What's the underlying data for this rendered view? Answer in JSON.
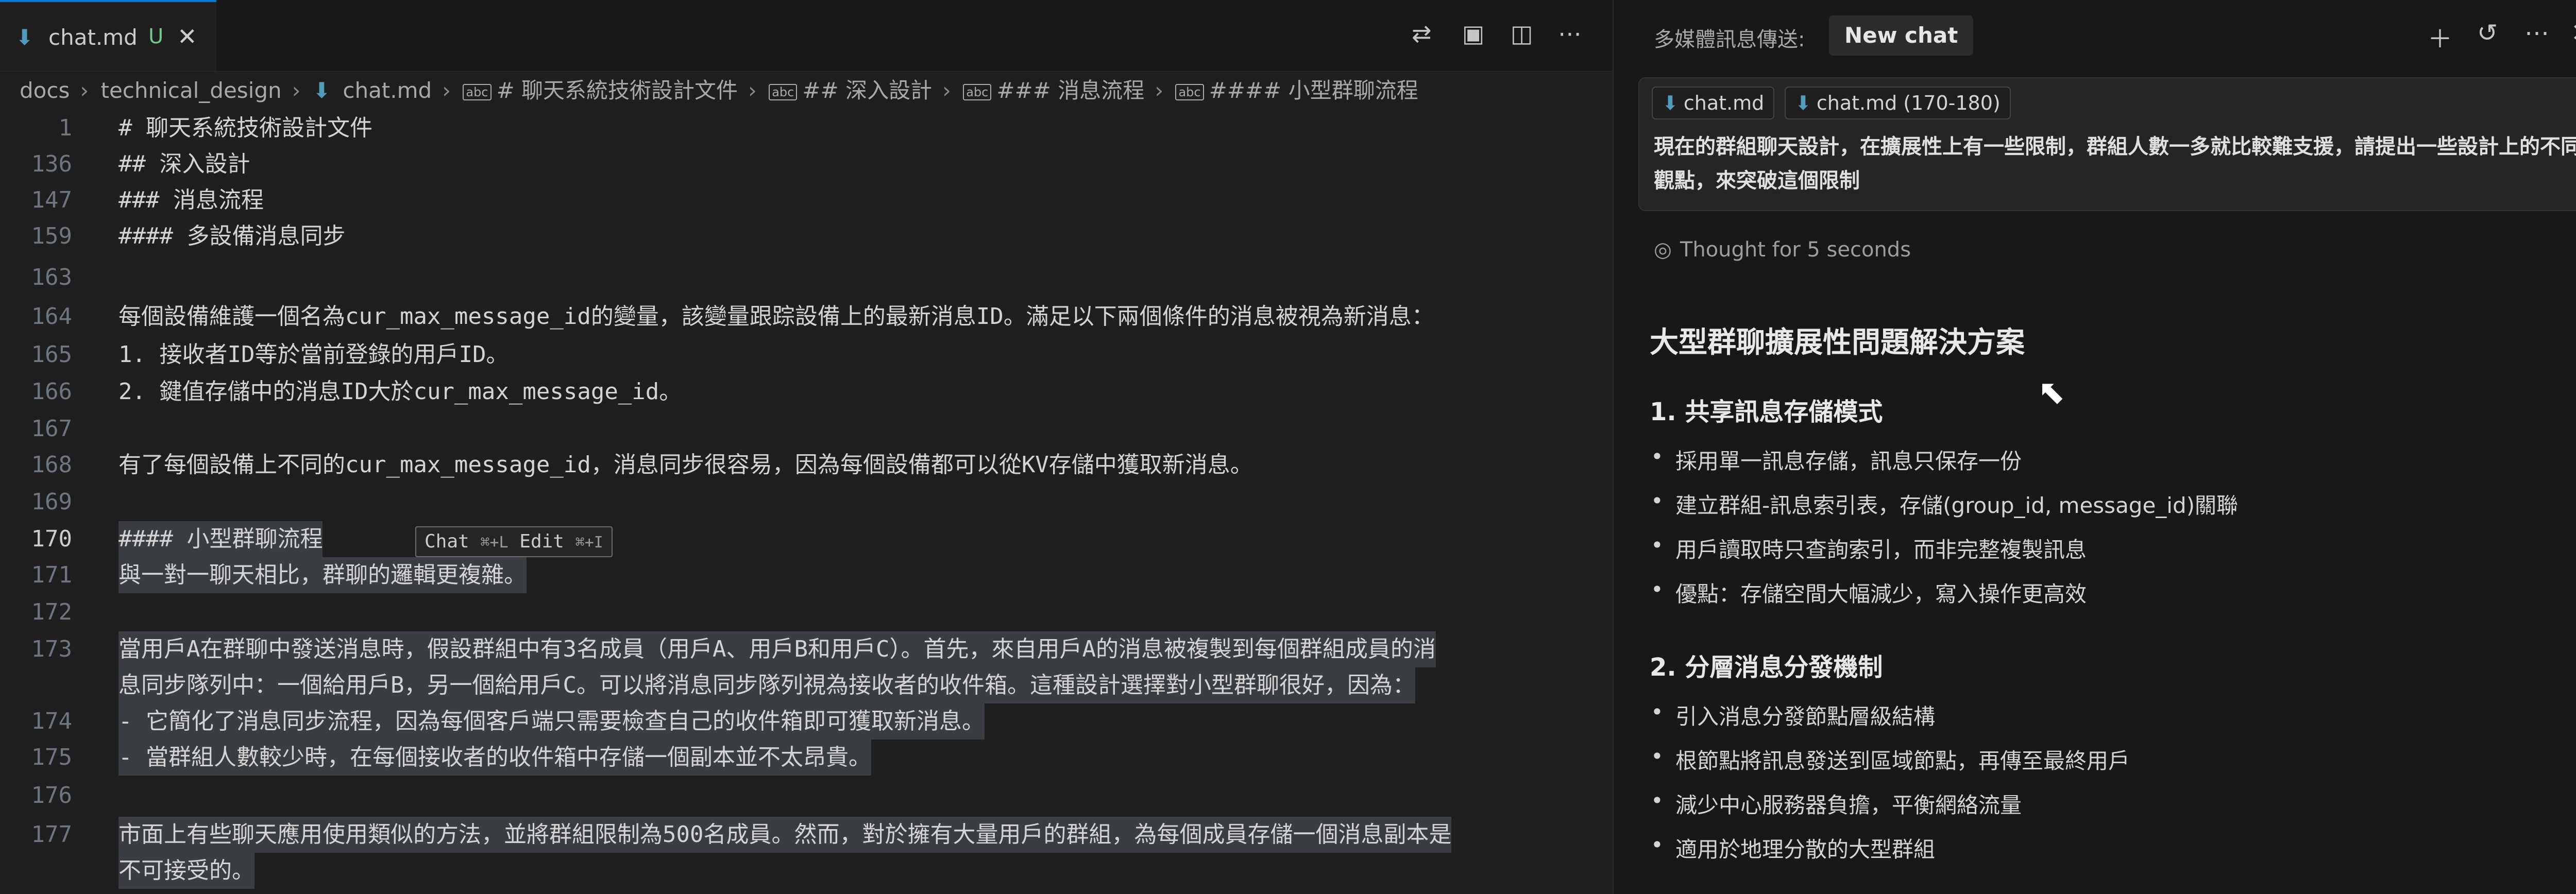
{
  "editor": {
    "tab": {
      "icon": "markdown-icon",
      "name": "chat.md",
      "status": "U",
      "close": "✕"
    },
    "breadcrumb": [
      "docs",
      "technical_design",
      "chat.md",
      "# 聊天系統技術設計文件",
      "## 深入設計",
      "### 消息流程",
      "#### 小型群聊流程"
    ],
    "lines": [
      {
        "num": "1",
        "text": "# 聊天系統技術設計文件"
      },
      {
        "num": "136",
        "text": "## 深入設計"
      },
      {
        "num": "147",
        "text": "### 消息流程"
      },
      {
        "num": "159",
        "text": "#### 多設備消息同步"
      },
      {
        "num": "163",
        "text": ""
      },
      {
        "num": "164",
        "text": "每個設備維護一個名為cur_max_message_id的變量，該變量跟踪設備上的最新消息ID。滿足以下兩個條件的消息被視為新消息："
      },
      {
        "num": "165",
        "text": "1. 接收者ID等於當前登錄的用戶ID。"
      },
      {
        "num": "166",
        "text": "2. 鍵值存儲中的消息ID大於cur_max_message_id。"
      },
      {
        "num": "167",
        "text": ""
      },
      {
        "num": "168",
        "text": "有了每個設備上不同的cur_max_message_id，消息同步很容易，因為每個設備都可以從KV存儲中獲取新消息。"
      },
      {
        "num": "169",
        "text": ""
      },
      {
        "num": "170",
        "text": "#### 小型群聊流程"
      },
      {
        "num": "171",
        "text": "與一對一聊天相比，群聊的邏輯更複雜。"
      },
      {
        "num": "172",
        "text": ""
      },
      {
        "num": "173",
        "text": "當用戶A在群聊中發送消息時，假設群組中有3名成員（用戶A、用戶B和用戶C）。首先，來自用戶A的消息被複製到每個群組成員的消"
      },
      {
        "num": "",
        "text": "息同步隊列中：一個給用戶B，另一個給用戶C。可以將消息同步隊列視為接收者的收件箱。這種設計選擇對小型群聊很好，因為："
      },
      {
        "num": "174",
        "text": "- 它簡化了消息同步流程，因為每個客戶端只需要檢查自己的收件箱即可獲取新消息。"
      },
      {
        "num": "175",
        "text": "- 當群組人數較少時，在每個接收者的收件箱中存儲一個副本並不太昂貴。"
      },
      {
        "num": "176",
        "text": ""
      },
      {
        "num": "177",
        "text": "市面上有些聊天應用使用類似的方法，並將群組限制為500名成員。然而，對於擁有大量用戶的群組，為每個成員存儲一個消息副本是"
      },
      {
        "num": "",
        "text": "不可接受的。"
      }
    ],
    "inline_hint": {
      "chat": "Chat",
      "chat_key": "⌘+L",
      "edit": "Edit",
      "edit_key": "⌘+I"
    }
  },
  "chat_panel": {
    "title": "多媒體訊息傳送:",
    "new_chat_label": "New chat",
    "chips": [
      "chat.md",
      "chat.md (170-180)"
    ],
    "prompt": "現在的群組聊天設計，在擴展性上有一些限制，群組人數一多就比較難支援，請提出一些設計上的不同觀點，來突破這個限制",
    "thought": "Thought for 5 seconds",
    "answer_title": "大型群聊擴展性問題解決方案",
    "sections": [
      {
        "title": "1. 共享訊息存儲模式",
        "bullets": [
          "採用單一訊息存儲，訊息只保存一份",
          "建立群組-訊息索引表，存儲(group_id, message_id)關聯",
          "用戶讀取時只查詢索引，而非完整複製訊息",
          "優點：存儲空間大幅減少，寫入操作更高效"
        ]
      },
      {
        "title": "2. 分層消息分發機制",
        "bullets": [
          "引入消息分發節點層級結構",
          "根節點將訊息發送到區域節點，再傳至最終用戶",
          "減少中心服務器負擔，平衡網絡流量",
          "適用於地理分散的大型群組"
        ]
      }
    ]
  },
  "colors": {
    "accent": "#0078d4",
    "markdown_icon": "#519aba",
    "untracked": "#73c991"
  }
}
